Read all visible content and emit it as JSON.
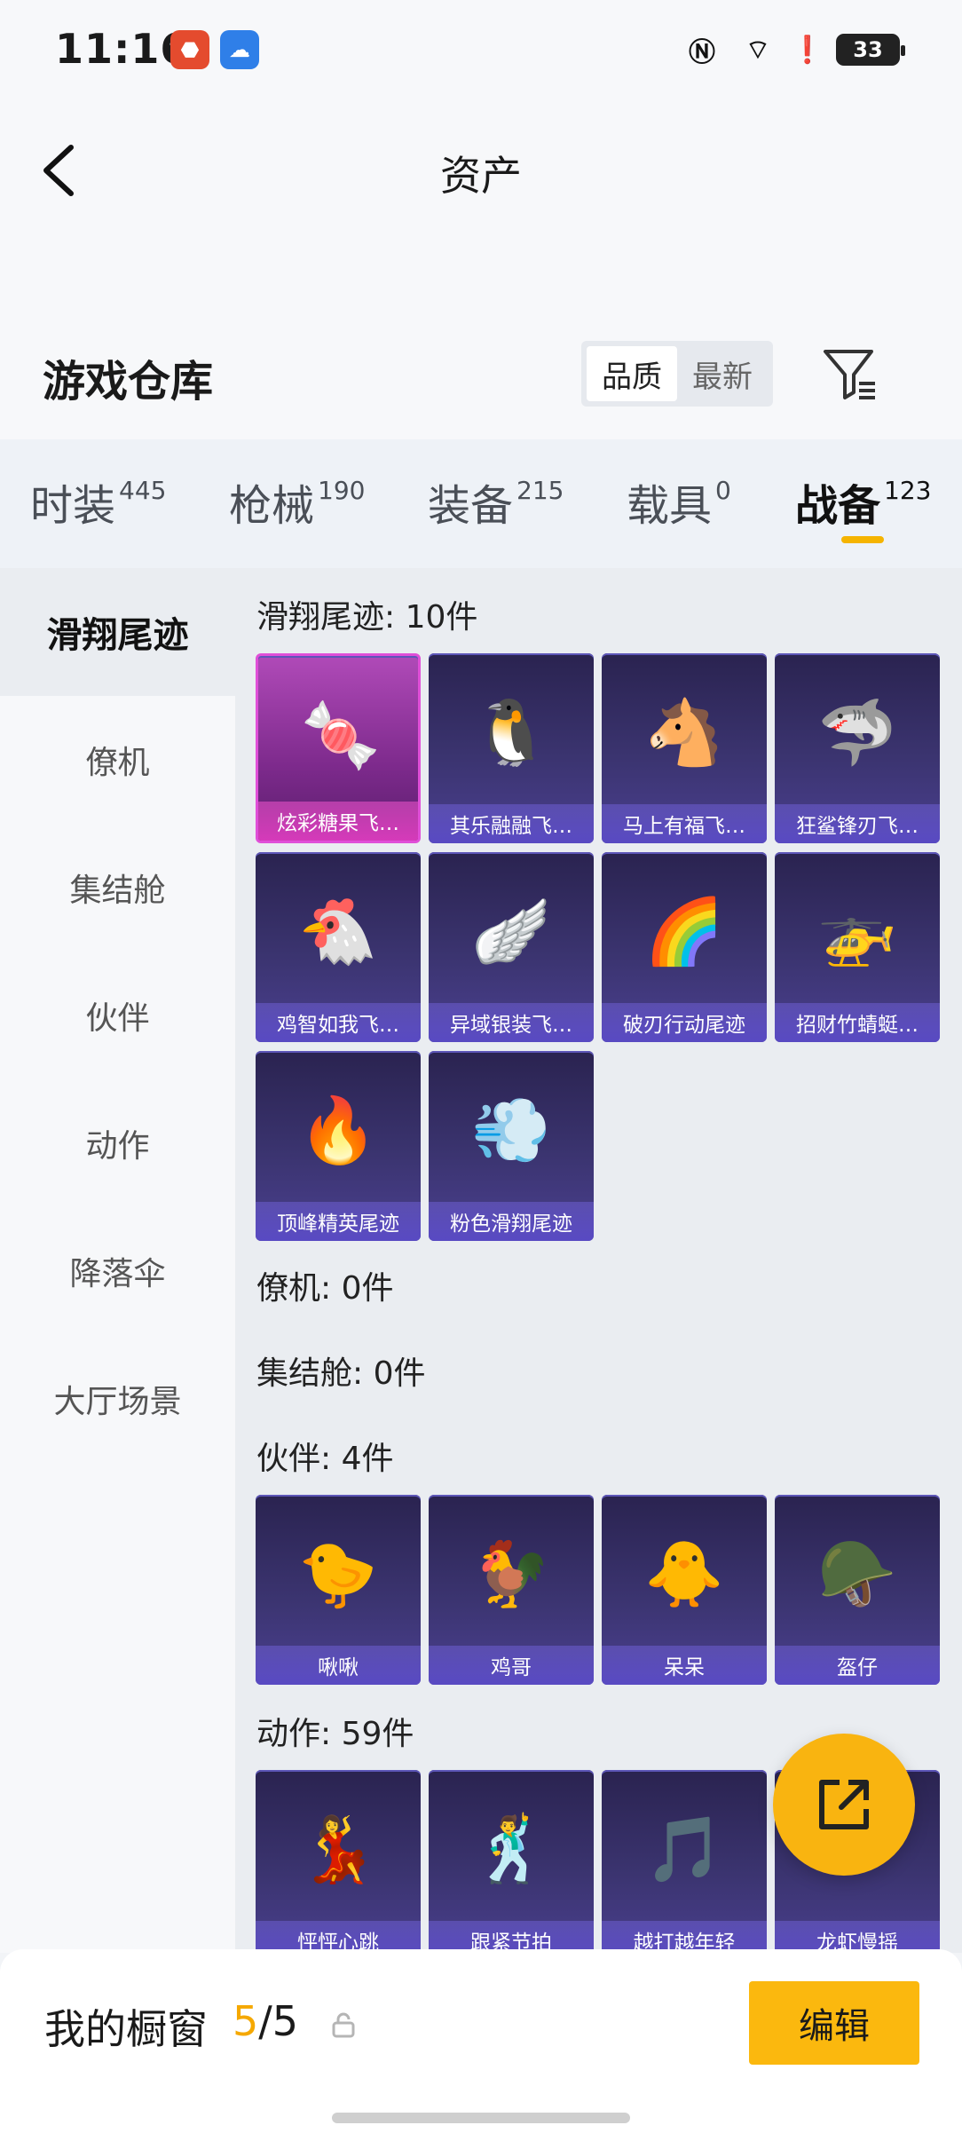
{
  "status": {
    "time": "11:16",
    "battery": "33"
  },
  "header": {
    "title": "资产"
  },
  "warehouse": {
    "title": "游戏仓库",
    "sort_quality": "品质",
    "sort_latest": "最新"
  },
  "tabs": [
    {
      "label": "时装",
      "count": "445"
    },
    {
      "label": "枪械",
      "count": "190"
    },
    {
      "label": "装备",
      "count": "215"
    },
    {
      "label": "载具",
      "count": "0"
    },
    {
      "label": "战备",
      "count": "123"
    }
  ],
  "sidebar": [
    "滑翔尾迹",
    "僚机",
    "集结舱",
    "伙伴",
    "动作",
    "降落伞",
    "大厅场景"
  ],
  "sections": {
    "glide": "滑翔尾迹: 10件",
    "wingman": "僚机: 0件",
    "pod": "集结舱: 0件",
    "partner": "伙伴: 4件",
    "emote": "动作: 59件"
  },
  "items": {
    "glide": [
      "炫彩糖果飞…",
      "其乐融融飞…",
      "马上有福飞…",
      "狂鲨锋刃飞…",
      "鸡智如我飞…",
      "异域银装飞…",
      "破刃行动尾迹",
      "招财竹蜻蜓…",
      "顶峰精英尾迹",
      "粉色滑翔尾迹"
    ],
    "partner": [
      "啾啾",
      "鸡哥",
      "呆呆",
      "盔仔"
    ],
    "emote": [
      "怦怦心跳",
      "跟紧节拍",
      "越打越年轻",
      "龙虾慢摇"
    ]
  },
  "bottom": {
    "showcase_label": "我的橱窗",
    "current": "5",
    "sep": "/",
    "total": "5",
    "edit": "编辑"
  }
}
